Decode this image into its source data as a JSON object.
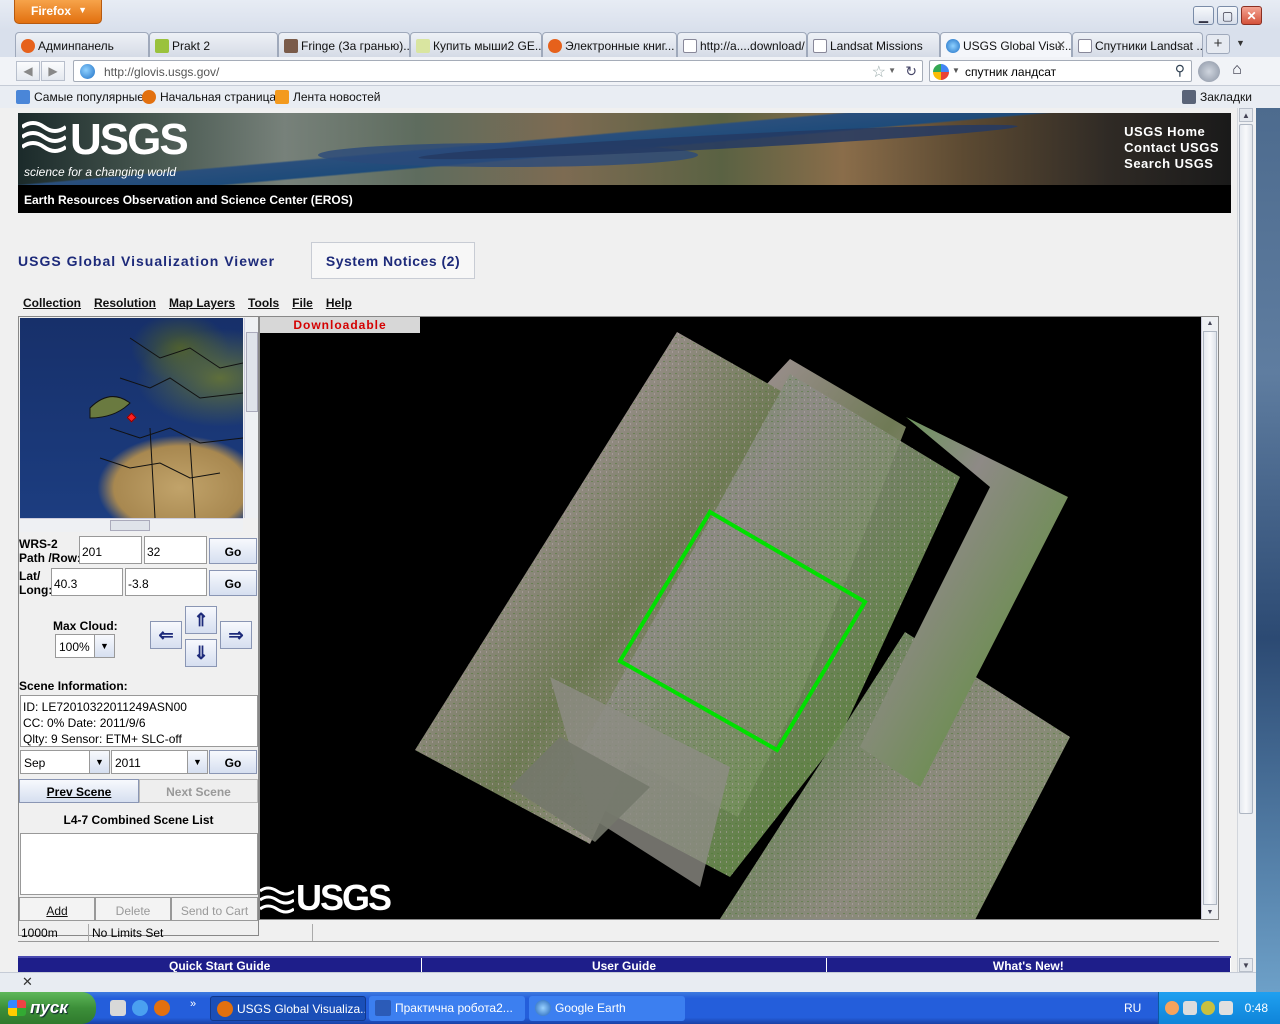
{
  "browser": {
    "menu_button": "Firefox",
    "tabs": [
      {
        "label": "Админпанель"
      },
      {
        "label": "Prakt 2"
      },
      {
        "label": "Fringe (За гранью)..."
      },
      {
        "label": "Купить мыши2 GE..."
      },
      {
        "label": "Электронные книг..."
      },
      {
        "label": "http://a....download/"
      },
      {
        "label": "Landsat Missions"
      },
      {
        "label": "USGS Global Visu..."
      },
      {
        "label": "Спутники Landsat ..."
      }
    ],
    "active_tab_index": 7,
    "url": "http://glovis.usgs.gov/",
    "search_query": "спутник ландсат",
    "bookmarks": [
      {
        "label": "Самые популярные"
      },
      {
        "label": "Начальная страница"
      },
      {
        "label": "Лента новостей"
      }
    ],
    "bookmarks_menu": "Закладки"
  },
  "header": {
    "logo_word": "USGS",
    "tagline": "science for a changing world",
    "links": [
      "USGS Home",
      "Contact USGS",
      "Search USGS"
    ],
    "eros_title": "Earth Resources Observation and Science Center (EROS)"
  },
  "viewer": {
    "title": "USGS Global Visualization Viewer",
    "notices_button": "System Notices (2)",
    "menu": [
      "Collection",
      "Resolution",
      "Map Layers",
      "Tools",
      "File",
      "Help"
    ]
  },
  "controls": {
    "wrs_label_1": "WRS-2",
    "wrs_label_2": "Path /Row:",
    "path": "201",
    "row": "32",
    "go": "Go",
    "lat_label_1": "Lat/",
    "lat_label_2": "Long:",
    "lat": "40.3",
    "long": "-3.8",
    "max_cloud_label": "Max Cloud:",
    "max_cloud_value": "100%",
    "scene_info_label": "Scene Information:",
    "scene_id": "ID: LE72010322011249ASN00",
    "scene_cc_date": "CC: 0%    Date: 2011/9/6",
    "scene_qlty": "Qlty: 9  Sensor: ETM+ SLC-off",
    "month": "Sep",
    "year": "2011",
    "prev_scene": "Prev Scene",
    "next_scene": "Next Scene",
    "scene_list_title": "L4-7 Combined Scene List",
    "add": "Add",
    "delete": "Delete",
    "send_to_cart": "Send to Cart"
  },
  "map": {
    "downloadable_label": "Downloadable",
    "logo_word": "USGS",
    "selection_color": "#00e000"
  },
  "status": {
    "resolution": "1000m",
    "limits": "No Limits Set"
  },
  "footer": [
    "Quick Start Guide",
    "User Guide",
    "What's New!"
  ],
  "taskbar": {
    "start": "пуск",
    "tasks": [
      "USGS Global Visualiza...",
      "Практична робота2...",
      "Google Earth"
    ],
    "lang": "RU",
    "time": "0:48"
  }
}
